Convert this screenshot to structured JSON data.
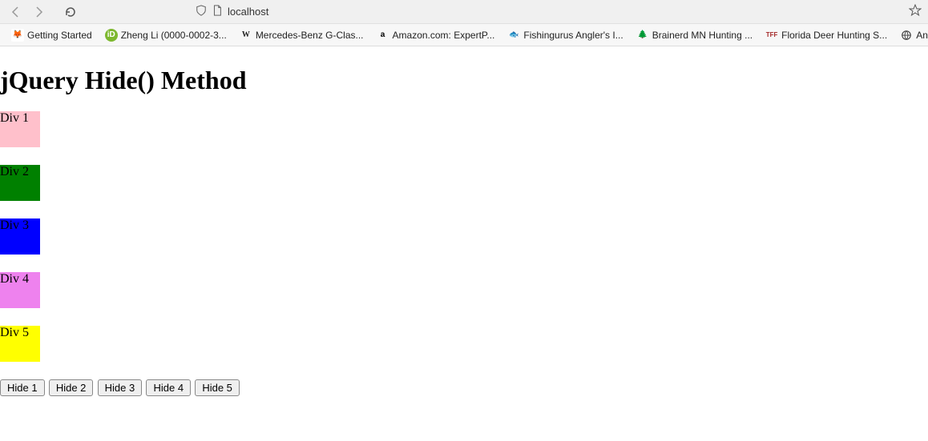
{
  "browser": {
    "url": "localhost",
    "bookmarks": [
      {
        "label": "Getting Started",
        "icon": "ff"
      },
      {
        "label": "Zheng Li (0000-0002-3...",
        "icon": "green"
      },
      {
        "label": "Mercedes-Benz G-Clas...",
        "icon": "w"
      },
      {
        "label": "Amazon.com: ExpertP...",
        "icon": "a"
      },
      {
        "label": "Fishingurus Angler's I...",
        "icon": "fish"
      },
      {
        "label": "Brainerd MN Hunting ...",
        "icon": "tree"
      },
      {
        "label": "Florida Deer Hunting S...",
        "icon": "tff"
      },
      {
        "label": "Another res",
        "icon": "globe"
      }
    ]
  },
  "page": {
    "heading": "jQuery Hide() Method",
    "boxes": [
      {
        "label": "Div 1",
        "color": "pink"
      },
      {
        "label": "Div 2",
        "color": "green"
      },
      {
        "label": "Div 3",
        "color": "blue"
      },
      {
        "label": "Div 4",
        "color": "violet"
      },
      {
        "label": "Div 5",
        "color": "yellow"
      }
    ],
    "buttons": [
      {
        "label": "Hide 1"
      },
      {
        "label": "Hide 2"
      },
      {
        "label": "Hide 3"
      },
      {
        "label": "Hide 4"
      },
      {
        "label": "Hide 5"
      }
    ]
  }
}
